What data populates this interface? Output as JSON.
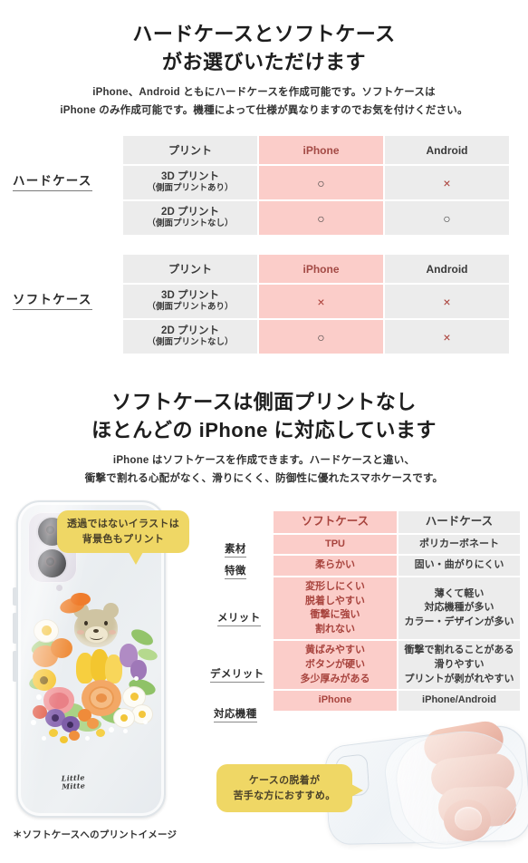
{
  "section1": {
    "heading_line1": "ハードケースとソフトケース",
    "heading_line2": "がお選びいただけます",
    "lead_line1": "iPhone、Android ともにハードケースを作成可能です。ソフトケースは",
    "lead_line2": "iPhone のみ作成可能です。機種によって仕様が異なりますのでお気を付けください。",
    "tables": [
      {
        "row_label": "ハードケース",
        "headers": [
          "プリント",
          "iPhone",
          "Android"
        ],
        "rows": [
          {
            "print_title": "3D プリント",
            "print_sub": "（側面プリントあり）",
            "iphone": "○",
            "android": "×"
          },
          {
            "print_title": "2D プリント",
            "print_sub": "（側面プリントなし）",
            "iphone": "○",
            "android": "○"
          }
        ]
      },
      {
        "row_label": "ソフトケース",
        "headers": [
          "プリント",
          "iPhone",
          "Android"
        ],
        "rows": [
          {
            "print_title": "3D プリント",
            "print_sub": "（側面プリントあり）",
            "iphone": "×",
            "android": "×"
          },
          {
            "print_title": "2D プリント",
            "print_sub": "（側面プリントなし）",
            "iphone": "○",
            "android": "×"
          }
        ]
      }
    ]
  },
  "section2": {
    "heading_line1": "ソフトケースは側面プリントなし",
    "heading_line2": "ほとんどの iPhone に対応しています",
    "lead_line1": "iPhone はソフトケースを作成できます。ハードケースと違い、",
    "lead_line2": "衝撃で割れる心配がなく、滑りにくく、防御性に優れたスマホケースです。",
    "bubble_top": "透過ではないイラストは\n背景色もプリント",
    "bubble_top_line1": "透過ではないイラストは",
    "bubble_top_line2": "背景色もプリント",
    "bubble_bottom_line1": "ケースの脱着が",
    "bubble_bottom_line2": "苦手な方におすすめ。",
    "phone_signature_line1": "Little",
    "phone_signature_line2": "Mitte",
    "footnote": "＊ソフトケースへのプリントイメージ",
    "comparison": {
      "headers": [
        "",
        "ソフトケース",
        "ハードケース"
      ],
      "rows": [
        {
          "label": "素材",
          "soft": "TPU",
          "hard": "ポリカーボネート"
        },
        {
          "label": "特徴",
          "soft": "柔らかい",
          "hard": "固い・曲がりにくい"
        },
        {
          "label": "メリット",
          "soft_lines": [
            "変形しにくい",
            "脱着しやすい",
            "衝撃に強い",
            "割れない"
          ],
          "hard_lines": [
            "薄くて軽い",
            "対応機種が多い",
            "カラー・デザインが多い"
          ]
        },
        {
          "label": "デメリット",
          "soft_lines": [
            "黄ばみやすい",
            "ボタンが硬い",
            "多少厚みがある"
          ],
          "hard_lines": [
            "衝撃で割れることがある",
            "滑りやすい",
            "プリントが剥がれやすい"
          ]
        },
        {
          "label": "対応機種",
          "soft": "iPhone",
          "hard": "iPhone/Android"
        }
      ]
    }
  },
  "colors": {
    "pink": "#FBCDC9",
    "gray": "#ECECEC",
    "yellow": "#EFD765",
    "mark_x": "#A83A33",
    "pink_text": "#A8443E"
  }
}
